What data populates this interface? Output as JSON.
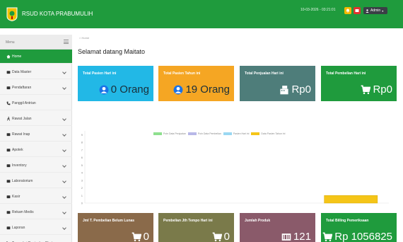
{
  "header": {
    "app_title": "RSUD KOTA PRABUMULIH",
    "datetime": "10-03-2026 - 03:21:01",
    "user_label": "Admin"
  },
  "sidebar": {
    "menu_label": "Menu",
    "items": [
      {
        "label": "Home",
        "icon": "home-icon",
        "active": true,
        "expand": false
      },
      {
        "label": "Data Master",
        "icon": "folder-icon",
        "active": false,
        "expand": true
      },
      {
        "label": "Pendaftaran",
        "icon": "list-icon",
        "active": false,
        "expand": true
      },
      {
        "label": "Panggil Antrian",
        "icon": "phone-icon",
        "active": false,
        "expand": false
      },
      {
        "label": "Rawat Jalan",
        "icon": "walk-icon",
        "active": false,
        "expand": true
      },
      {
        "label": "Rawat Inap",
        "icon": "bed-icon",
        "active": false,
        "expand": true
      },
      {
        "label": "Apotek",
        "icon": "pill-icon",
        "active": false,
        "expand": true
      },
      {
        "label": "Inventory",
        "icon": "box-icon",
        "active": false,
        "expand": true
      },
      {
        "label": "Laboratorium",
        "icon": "flask-icon",
        "active": false,
        "expand": true
      },
      {
        "label": "Kasir",
        "icon": "cash-icon",
        "active": false,
        "expand": true
      },
      {
        "label": "Rekam Medis",
        "icon": "record-icon",
        "active": false,
        "expand": true
      },
      {
        "label": "Laporan",
        "icon": "report-icon",
        "active": false,
        "expand": true
      },
      {
        "label": "Transaksi Penjualan Obat",
        "icon": "cart-icon",
        "active": false,
        "expand": false
      }
    ]
  },
  "breadcrumb": "Home",
  "welcome_title": "Selamat datang Maitato",
  "cards_top": [
    {
      "label": "Total Pasien Hari ini",
      "value": "0 Orang",
      "icon": "user-icon",
      "bg": "#22b8e6",
      "fg": "#1a2f3a"
    },
    {
      "label": "Total Pasien Tahun ini",
      "value": "19 Orang",
      "icon": "user-icon",
      "bg": "#f5a623",
      "fg": "#1a2f3a"
    },
    {
      "label": "Total Penjualan Hari ini",
      "value": "Rp0",
      "icon": "register-icon",
      "bg": "#4e7d7a",
      "fg": "#ffffff"
    },
    {
      "label": "Total Pembelian Hari ini",
      "value": "Rp0",
      "icon": "cart-icon",
      "bg": "#1f9b3d",
      "fg": "#ffffff"
    }
  ],
  "cards_bottom": [
    {
      "label": "Jml T. Pembelian Belum Lunas",
      "value": "0",
      "icon": "cart-icon",
      "bg": "#8a6a4a",
      "fg": "#ffffff"
    },
    {
      "label": "Pembelian Jth Tempo Hari ini",
      "value": "0",
      "icon": "cart-icon",
      "bg": "#7a7a4a",
      "fg": "#ffffff"
    },
    {
      "label": "Jumlah Produk",
      "value": "121",
      "icon": "barcode-icon",
      "bg": "#8a5a6a",
      "fg": "#ffffff"
    },
    {
      "label": "Total Billing Pemeriksaan",
      "value": "Rp 1056825",
      "icon": "cart-icon",
      "bg": "#1f9b3d",
      "fg": "#ffffff"
    }
  ],
  "chart_data": {
    "type": "bar",
    "series": [
      {
        "name": "Poin Data Penjualan",
        "color": "#8fe08f",
        "values": [
          0
        ]
      },
      {
        "name": "Poin Data Pembelian",
        "color": "#b8b8e8",
        "values": [
          0
        ]
      },
      {
        "name": "Pasien Hari ini",
        "color": "#9ad8f2",
        "values": [
          0
        ]
      },
      {
        "name": "Data Pasien Tahun ini",
        "color": "#f5c518",
        "values": [
          1
        ]
      }
    ],
    "y_ticks": [
      "0",
      "1",
      "2",
      "3",
      "4",
      "5",
      "6",
      "7",
      "8",
      "9"
    ],
    "ylim": [
      0,
      9.5
    ],
    "grid": false,
    "legend_position": "top"
  }
}
